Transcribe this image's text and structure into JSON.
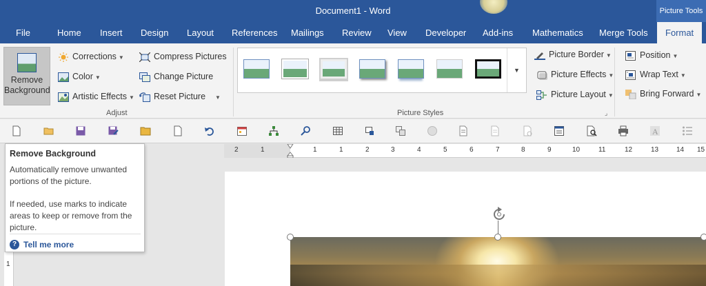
{
  "window": {
    "title": "Document1 - Word",
    "context_tab_header": "Picture Tools"
  },
  "tabs": [
    {
      "label": "File"
    },
    {
      "label": "Home"
    },
    {
      "label": "Insert"
    },
    {
      "label": "Design"
    },
    {
      "label": "Layout"
    },
    {
      "label": "References"
    },
    {
      "label": "Mailings"
    },
    {
      "label": "Review"
    },
    {
      "label": "View"
    },
    {
      "label": "Developer"
    },
    {
      "label": "Add-ins"
    },
    {
      "label": "Mathematics"
    },
    {
      "label": "Merge Tools"
    },
    {
      "label": "Format",
      "active": true
    }
  ],
  "ribbon": {
    "adjust": {
      "remove_background": "Remove Background",
      "corrections": "Corrections",
      "color": "Color",
      "artistic_effects": "Artistic Effects",
      "compress_pictures": "Compress Pictures",
      "change_picture": "Change Picture",
      "reset_picture": "Reset Picture",
      "group_label": "Adjust"
    },
    "picture_styles": {
      "group_label": "Picture Styles",
      "thumbnail_count": 7,
      "picture_border": "Picture Border",
      "picture_effects": "Picture Effects",
      "picture_layout": "Picture Layout"
    },
    "arrange": {
      "position": "Position",
      "wrap_text": "Wrap Text",
      "bring_forward": "Bring Forward"
    }
  },
  "quick_toolbar": {
    "icons": [
      "new-document-icon",
      "open-folder-icon",
      "save-icon",
      "save-as-icon",
      "folder-icon",
      "blank-page-icon",
      "undo-icon",
      "calendar-icon",
      "org-chart-icon",
      "find-icon",
      "table-icon",
      "layout-icon",
      "shapes-icon",
      "circle-icon",
      "page-options-icon",
      "page-icon",
      "attachment-icon",
      "columns-icon",
      "print-preview-icon",
      "print-icon",
      "font-icon",
      "list-icon"
    ]
  },
  "ruler": {
    "labels": [
      "2",
      "1",
      "1",
      "1",
      "2",
      "3",
      "4",
      "5",
      "6",
      "7",
      "8",
      "9",
      "10",
      "11",
      "12",
      "13",
      "14",
      "15"
    ]
  },
  "vertical_ruler": {
    "label": "1"
  },
  "tooltip": {
    "title": "Remove Background",
    "line1": "Automatically remove unwanted portions of the picture.",
    "line2": "If needed, use marks to indicate areas to keep or remove from the picture.",
    "link": "Tell me more"
  },
  "colors": {
    "accent": "#2b579a",
    "ribbon_bg": "#f3f3f3"
  }
}
